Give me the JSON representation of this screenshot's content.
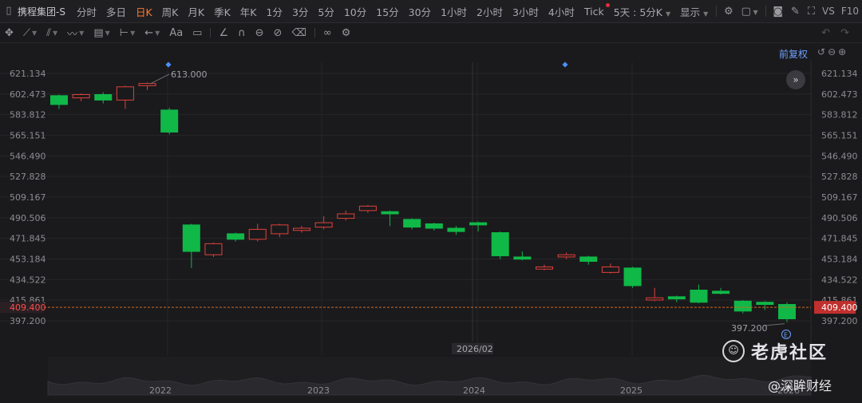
{
  "toolbar": {
    "symbol": "携程集团-S",
    "periods": [
      {
        "label": "分时",
        "active": false
      },
      {
        "label": "多日",
        "active": false
      },
      {
        "label": "日K",
        "active": true
      },
      {
        "label": "周K",
        "active": false
      },
      {
        "label": "月K",
        "active": false
      },
      {
        "label": "季K",
        "active": false
      },
      {
        "label": "年K",
        "active": false
      },
      {
        "label": "1分",
        "active": false
      },
      {
        "label": "3分",
        "active": false
      },
      {
        "label": "5分",
        "active": false
      },
      {
        "label": "10分",
        "active": false
      },
      {
        "label": "15分",
        "active": false
      },
      {
        "label": "30分",
        "active": false
      },
      {
        "label": "1小时",
        "active": false
      },
      {
        "label": "2小时",
        "active": false
      },
      {
        "label": "3小时",
        "active": false
      },
      {
        "label": "4小时",
        "active": false
      },
      {
        "label": "Tick",
        "active": false
      }
    ],
    "multi_period": "5天 : 5分K",
    "display": "显示",
    "vs_label": "VS",
    "f10_label": "F10"
  },
  "adjust_label": "前复权",
  "chart_data": {
    "type": "candlestick",
    "ylim": [
      397.2,
      621.134
    ],
    "y_ticks": [
      "621.134",
      "602.473",
      "583.812",
      "565.151",
      "546.490",
      "527.828",
      "509.167",
      "490.506",
      "471.845",
      "453.184",
      "434.522",
      "415.861",
      "397.200"
    ],
    "current_price": "409.400",
    "high_marker": "613.000",
    "low_marker": "397.200",
    "cursor_date": "2026/02",
    "x_labels": [
      "2022",
      "2023",
      "2024",
      "2025",
      "2026"
    ],
    "candles": [
      {
        "o": 601,
        "c": 593,
        "h": 602,
        "l": 589
      },
      {
        "o": 599,
        "c": 602,
        "h": 603,
        "l": 596
      },
      {
        "o": 602,
        "c": 597,
        "h": 604,
        "l": 594
      },
      {
        "o": 597,
        "c": 609,
        "h": 610,
        "l": 589
      },
      {
        "o": 610,
        "c": 612,
        "h": 613,
        "l": 606
      },
      {
        "o": 588,
        "c": 568,
        "h": 590,
        "l": 566
      },
      {
        "o": 484,
        "c": 460,
        "h": 485,
        "l": 445
      },
      {
        "o": 457,
        "c": 467,
        "h": 468,
        "l": 455
      },
      {
        "o": 476,
        "c": 471,
        "h": 477,
        "l": 469
      },
      {
        "o": 471,
        "c": 480,
        "h": 485,
        "l": 469
      },
      {
        "o": 476,
        "c": 484,
        "h": 485,
        "l": 473
      },
      {
        "o": 479,
        "c": 481,
        "h": 483,
        "l": 477
      },
      {
        "o": 482,
        "c": 486,
        "h": 492,
        "l": 480
      },
      {
        "o": 490,
        "c": 494,
        "h": 497,
        "l": 488
      },
      {
        "o": 497,
        "c": 501,
        "h": 502,
        "l": 495
      },
      {
        "o": 496,
        "c": 494,
        "h": 497,
        "l": 483
      },
      {
        "o": 489,
        "c": 482,
        "h": 490,
        "l": 480
      },
      {
        "o": 485,
        "c": 481,
        "h": 486,
        "l": 479
      },
      {
        "o": 481,
        "c": 478,
        "h": 483,
        "l": 475
      },
      {
        "o": 486,
        "c": 484,
        "h": 487,
        "l": 478
      },
      {
        "o": 477,
        "c": 456,
        "h": 478,
        "l": 453
      },
      {
        "o": 455,
        "c": 453,
        "h": 460,
        "l": 452
      },
      {
        "o": 444,
        "c": 446,
        "h": 448,
        "l": 443
      },
      {
        "o": 455,
        "c": 457,
        "h": 459,
        "l": 453
      },
      {
        "o": 455,
        "c": 451,
        "h": 456,
        "l": 448
      },
      {
        "o": 441,
        "c": 446,
        "h": 449,
        "l": 440
      },
      {
        "o": 445,
        "c": 429,
        "h": 446,
        "l": 427
      },
      {
        "o": 416,
        "c": 418,
        "h": 427,
        "l": 415
      },
      {
        "o": 419,
        "c": 417,
        "h": 420,
        "l": 414
      },
      {
        "o": 425,
        "c": 414,
        "h": 430,
        "l": 413
      },
      {
        "o": 424,
        "c": 422,
        "h": 427,
        "l": 421
      },
      {
        "o": 415,
        "c": 406,
        "h": 416,
        "l": 404
      },
      {
        "o": 414,
        "c": 412,
        "h": 415,
        "l": 407
      },
      {
        "o": 412,
        "c": 399,
        "h": 414,
        "l": 396
      }
    ]
  }
}
